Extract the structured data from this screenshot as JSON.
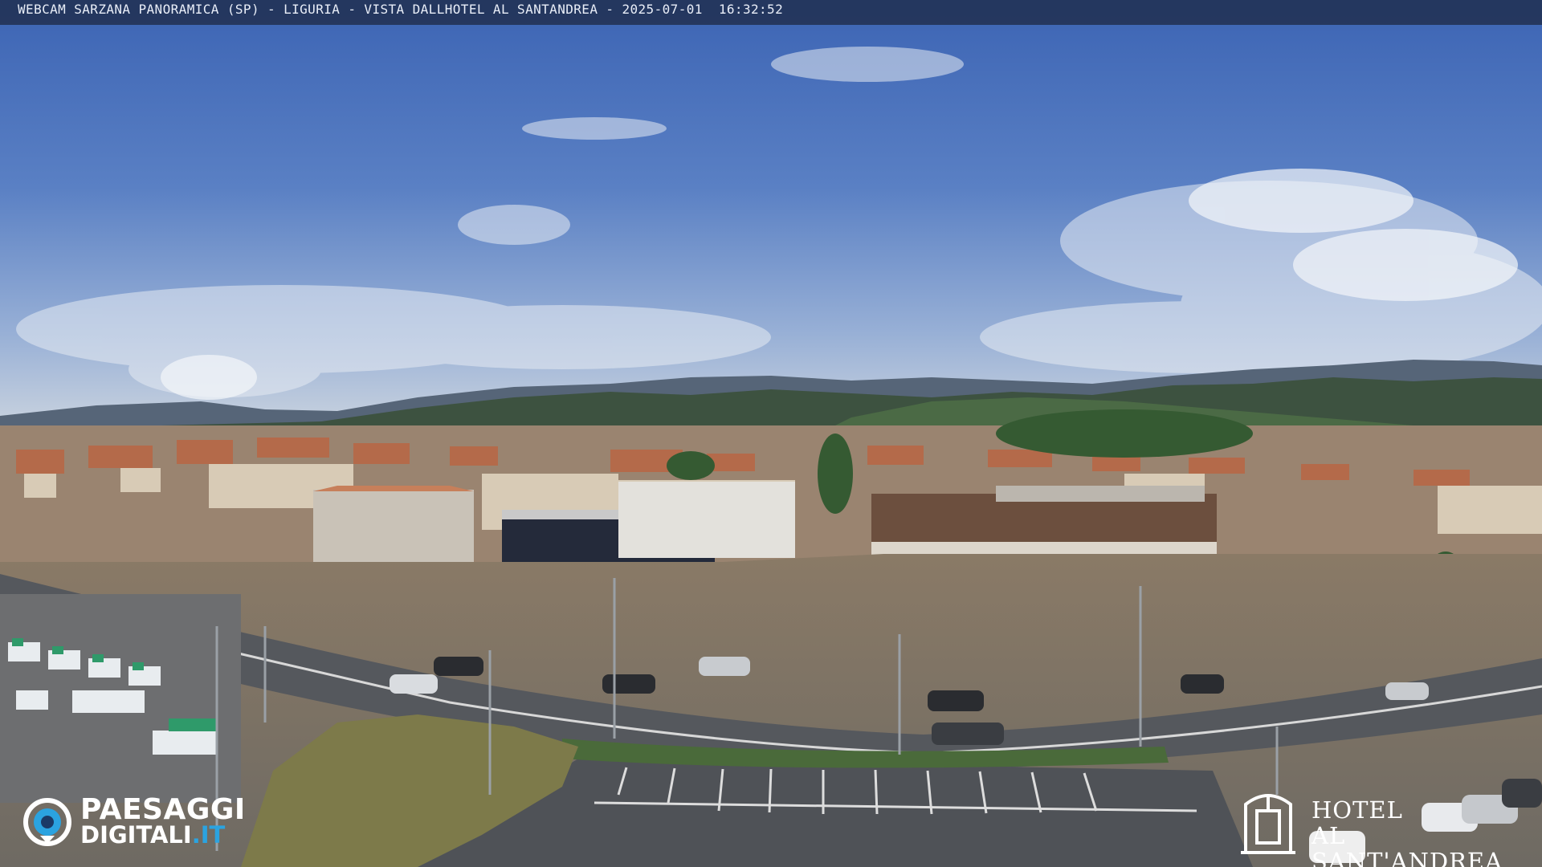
{
  "webcam": {
    "title": "WEBCAM SARZANA PANORAMICA (SP) - LIGURIA - VISTA DALLHOTEL AL SANTANDREA - 2025-07-01  16:32:52"
  },
  "branding": {
    "left_logo": {
      "line1": "PAESAGGI",
      "line2_main": "DIGITALI",
      "line2_accent": ".IT",
      "accent_color": "#2ba3e0"
    },
    "right_logo": {
      "line1": "HOTEL",
      "line2": "AL SANT'ANDREA"
    }
  },
  "colors": {
    "sky_top": "#3f68b8",
    "sky_horizon": "#b7c5d9",
    "hills": "#3b4e3c",
    "road": "#5a5d62"
  }
}
